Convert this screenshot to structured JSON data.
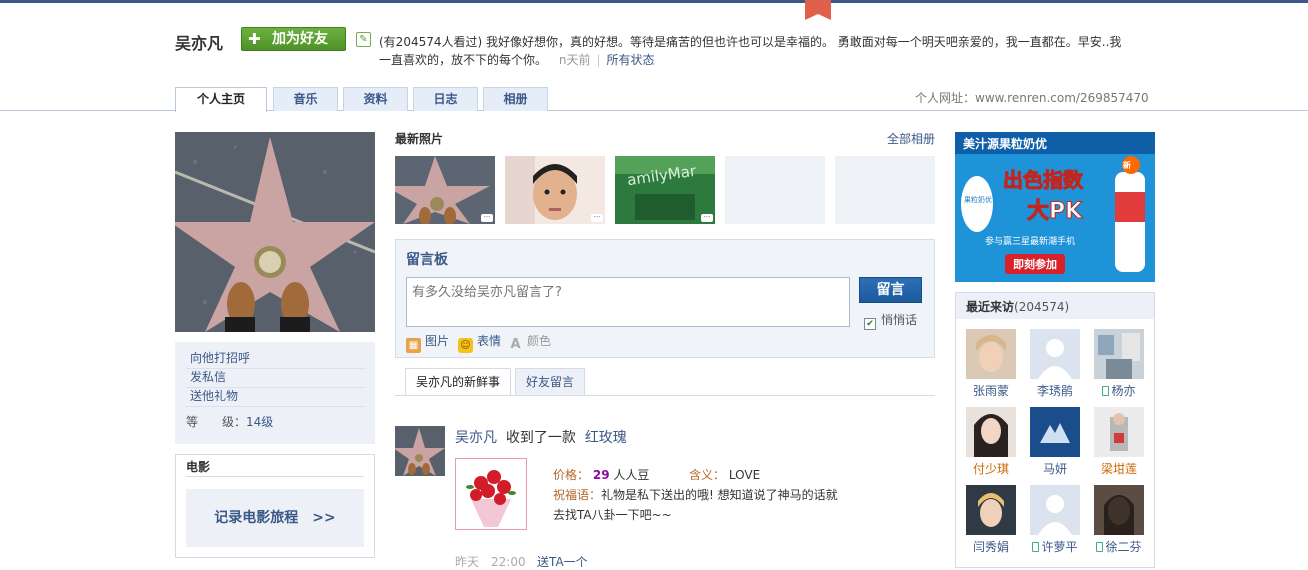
{
  "profile": {
    "name": "吴亦凡",
    "add_friend_label": "加为好友",
    "status_text": "(有204574人看过) 我好像好想你，真的好想。等待是痛苦的但也许也可以是幸福的。 勇敢面对每一个明天吧亲爱的，我一直都在。早安..我一直喜欢的，放不下的每个你。",
    "status_time": "n天前",
    "all_status_label": "所有状态"
  },
  "tabs": [
    {
      "label": "个人主页",
      "active": true
    },
    {
      "label": "音乐",
      "active": false
    },
    {
      "label": "资料",
      "active": false
    },
    {
      "label": "日志",
      "active": false
    },
    {
      "label": "相册",
      "active": false
    }
  ],
  "personal_url": "个人网址：www.renren.com/269857470",
  "left_actions": [
    "向他打招呼",
    "发私信",
    "送他礼物"
  ],
  "level": {
    "label": "等　　级：",
    "value": "14级"
  },
  "movie": {
    "title": "电影",
    "button": "记录电影旅程　>>"
  },
  "photos": {
    "title": "最新照片",
    "all_label": "全部相册"
  },
  "message_board": {
    "title": "留言板",
    "placeholder": "有多久没给吴亦凡留言了?",
    "submit": "留言",
    "quiet_label": "悄悄话",
    "tools": [
      "图片",
      "表情",
      "颜色"
    ]
  },
  "feed_tabs": [
    {
      "label": "吴亦凡的新鲜事",
      "active": true
    },
    {
      "label": "好友留言",
      "active": false
    }
  ],
  "feed": {
    "name": "吴亦凡",
    "action": "收到了一款",
    "gift": "红玫瑰",
    "price_label": "价格：",
    "price_value": "29",
    "price_unit": "人人豆",
    "meaning_label": "含义：",
    "meaning_value": "LOVE",
    "wish_label": "祝福语：",
    "wish_line1": "礼物是私下送出的哦! 想知道说了神马的话就",
    "wish_line2": "去找TA八卦一下吧~~",
    "time": "昨天　22:00",
    "reply": "送TA一个"
  },
  "ad": {
    "headline": "美汁源果粒奶优",
    "big_text_1": "出色指数",
    "big_text_2": "大PK",
    "sub_text": "参与赢三星最新潮手机",
    "cta": "即刻参加",
    "brand": "果粒奶优"
  },
  "visitors": {
    "title": "最近来访",
    "count": "(204574)",
    "list": [
      {
        "name": "张雨蒙",
        "phone": false,
        "red": false
      },
      {
        "name": "李琇鹃",
        "phone": false,
        "red": false
      },
      {
        "name": "杨亦",
        "phone": true,
        "red": false
      },
      {
        "name": "付少琪",
        "phone": false,
        "red": true
      },
      {
        "name": "马妍",
        "phone": false,
        "red": false
      },
      {
        "name": "梁坩莲",
        "phone": false,
        "red": true
      },
      {
        "name": "闫秀娟",
        "phone": false,
        "red": false
      },
      {
        "name": "许萝平",
        "phone": true,
        "red": false
      },
      {
        "name": "徐二芬",
        "phone": true,
        "red": false
      }
    ]
  },
  "colors": {
    "accent": "#3b5888",
    "add_friend": "#5a9e30",
    "button_blue": "#1b5a9c",
    "tab_bg": "#e4edf8"
  }
}
